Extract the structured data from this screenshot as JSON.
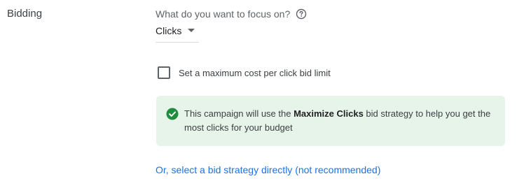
{
  "section": {
    "label": "Bidding"
  },
  "focus": {
    "question": "What do you want to focus on?",
    "help_icon": "help-circle-icon",
    "selected": "Clicks"
  },
  "max_cpc": {
    "label": "Set a maximum cost per click bid limit",
    "checked": false
  },
  "info": {
    "icon": "check-circle-icon",
    "text_before": "This campaign will use the ",
    "strategy_name": "Maximize Clicks",
    "text_after": " bid strategy to help you get the most clicks for your budget"
  },
  "link": {
    "label": "Or, select a bid strategy directly (not recommended)"
  },
  "colors": {
    "accent": "#1a73e8",
    "success": "#1e8e3e",
    "info_bg": "#e6f4ea"
  }
}
